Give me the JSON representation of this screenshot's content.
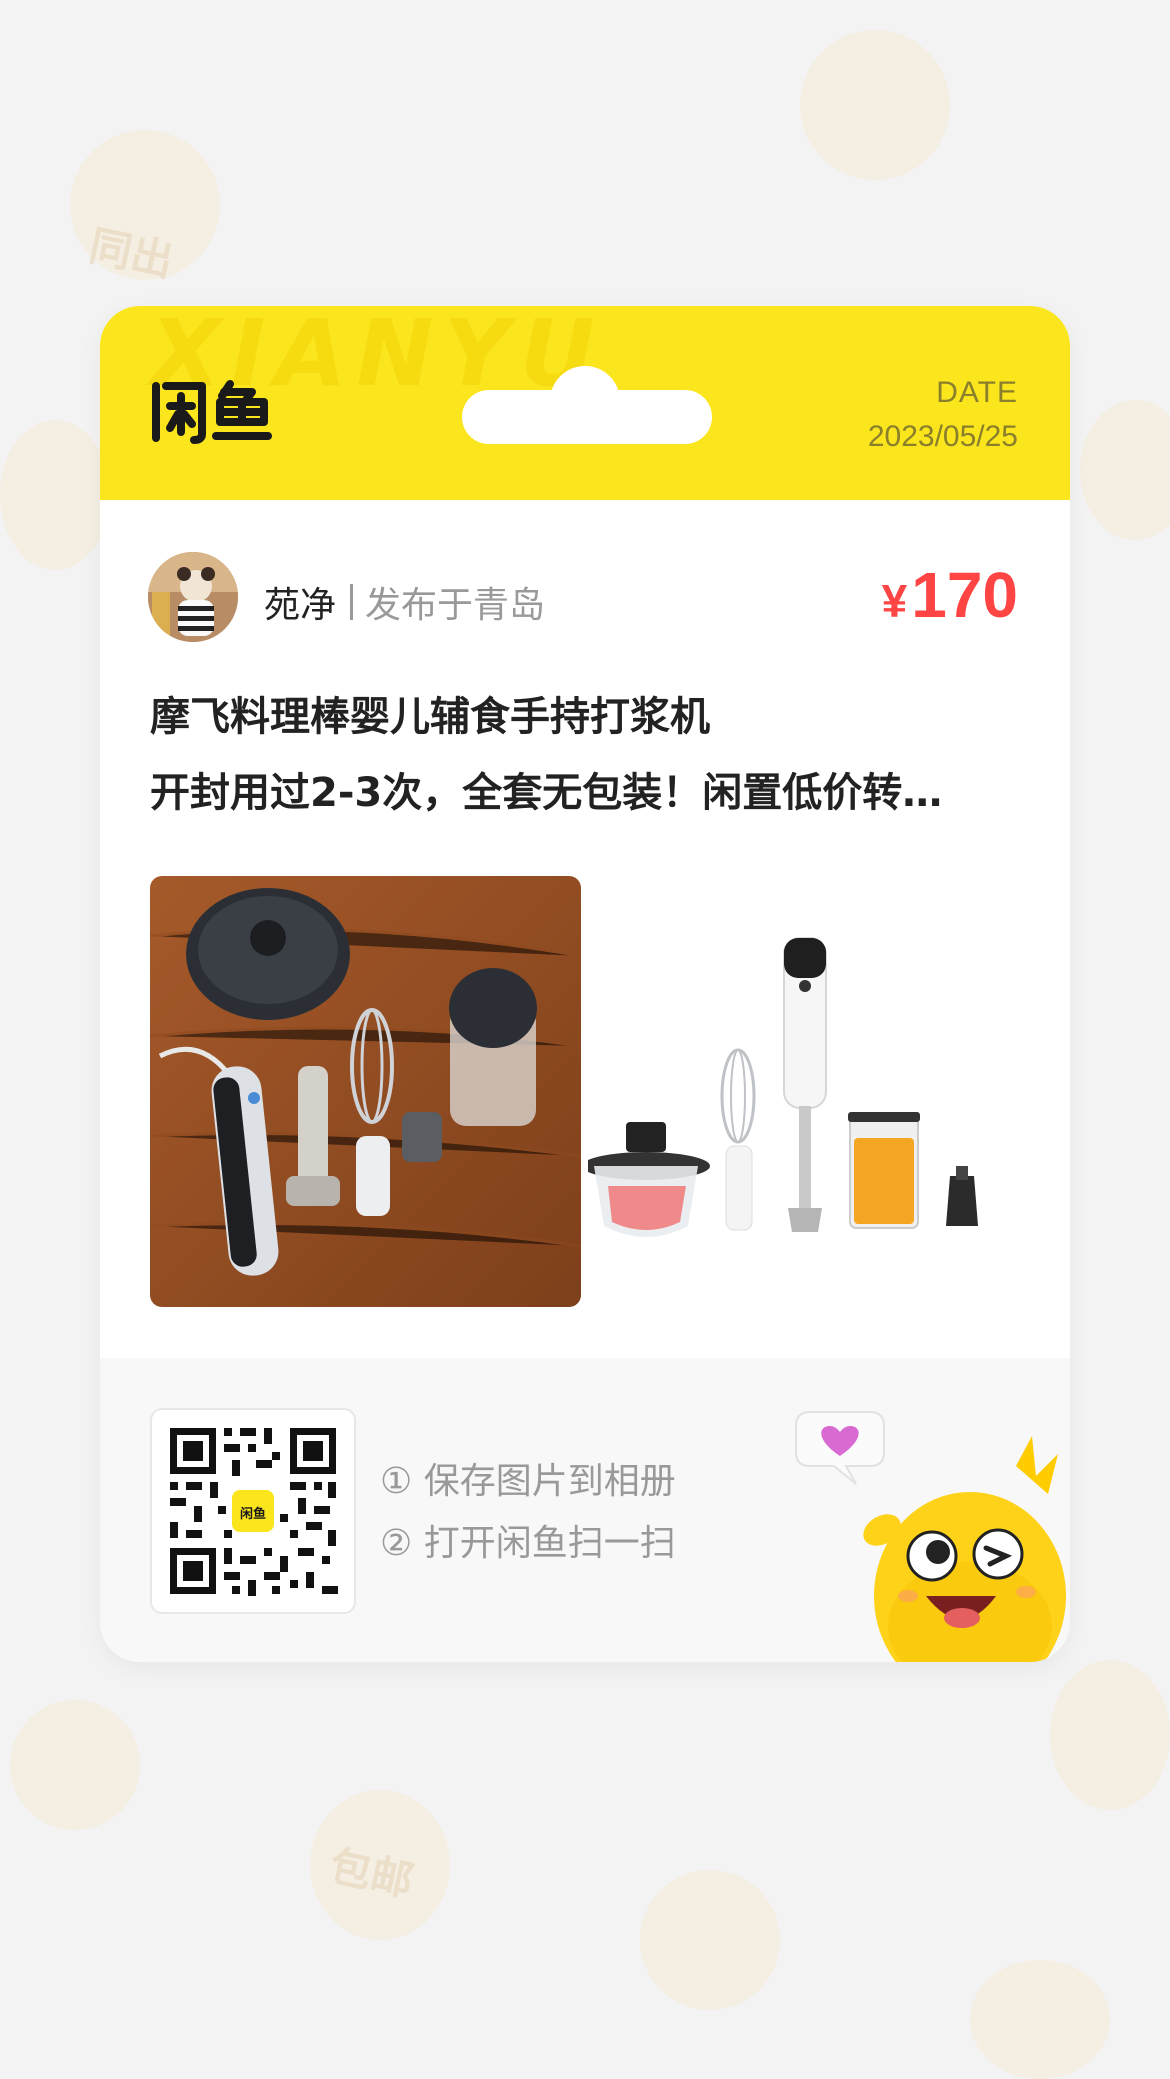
{
  "header": {
    "brand_logo": "闲鱼",
    "watermark": "XIANYU",
    "date_label": "DATE",
    "date_value": "2023/05/25"
  },
  "seller": {
    "name": "苑净",
    "location": "发布于青岛"
  },
  "price": {
    "currency": "¥",
    "amount": "170"
  },
  "item": {
    "title": "摩飞料理棒婴儿辅食手持打浆机",
    "description": "开封用过2-3次，全套无包装！闲置低价转…"
  },
  "footer": {
    "qr_center_label": "闲鱼",
    "step1": "① 保存图片到相册",
    "step2": "② 打开闲鱼扫一扫"
  },
  "background_tags": [
    "同出",
    "包邮"
  ],
  "colors": {
    "brand_yellow": "#fbe51d",
    "price_red": "#ff4444"
  }
}
